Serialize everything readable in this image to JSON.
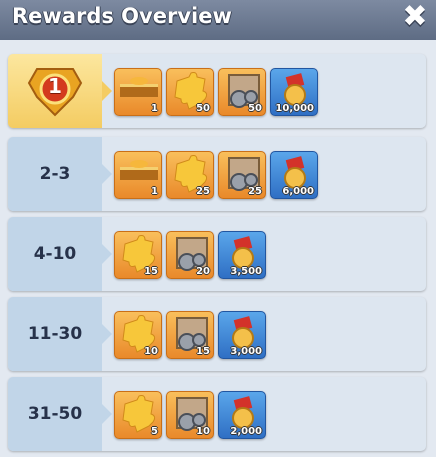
{
  "header": {
    "title": "Rewards Overview",
    "close_icon": "close-icon"
  },
  "colors": {
    "gold_row": "#f4cc62",
    "blue_row": "#c1d5e8",
    "panel": "#e3e9f1"
  },
  "rows": [
    {
      "rank": "1",
      "items": [
        {
          "icon": "chest-icon",
          "qty": "1"
        },
        {
          "icon": "puzzle-piece-icon",
          "qty": "50"
        },
        {
          "icon": "parts-crate-icon",
          "qty": "50"
        },
        {
          "icon": "medal-coin-icon",
          "qty": "10,000"
        }
      ]
    },
    {
      "rank": "2-3",
      "items": [
        {
          "icon": "chest-icon",
          "qty": "1"
        },
        {
          "icon": "puzzle-piece-icon",
          "qty": "25"
        },
        {
          "icon": "parts-crate-icon",
          "qty": "25"
        },
        {
          "icon": "medal-coin-icon",
          "qty": "6,000"
        }
      ]
    },
    {
      "rank": "4-10",
      "items": [
        {
          "icon": "puzzle-piece-icon",
          "qty": "15"
        },
        {
          "icon": "parts-crate-icon",
          "qty": "20"
        },
        {
          "icon": "medal-coin-icon",
          "qty": "3,500"
        }
      ]
    },
    {
      "rank": "11-30",
      "items": [
        {
          "icon": "puzzle-piece-icon",
          "qty": "10"
        },
        {
          "icon": "parts-crate-icon",
          "qty": "15"
        },
        {
          "icon": "medal-coin-icon",
          "qty": "3,000"
        }
      ]
    },
    {
      "rank": "31-50",
      "items": [
        {
          "icon": "puzzle-piece-icon",
          "qty": "5"
        },
        {
          "icon": "parts-crate-icon",
          "qty": "10"
        },
        {
          "icon": "medal-coin-icon",
          "qty": "2,000"
        }
      ]
    }
  ]
}
